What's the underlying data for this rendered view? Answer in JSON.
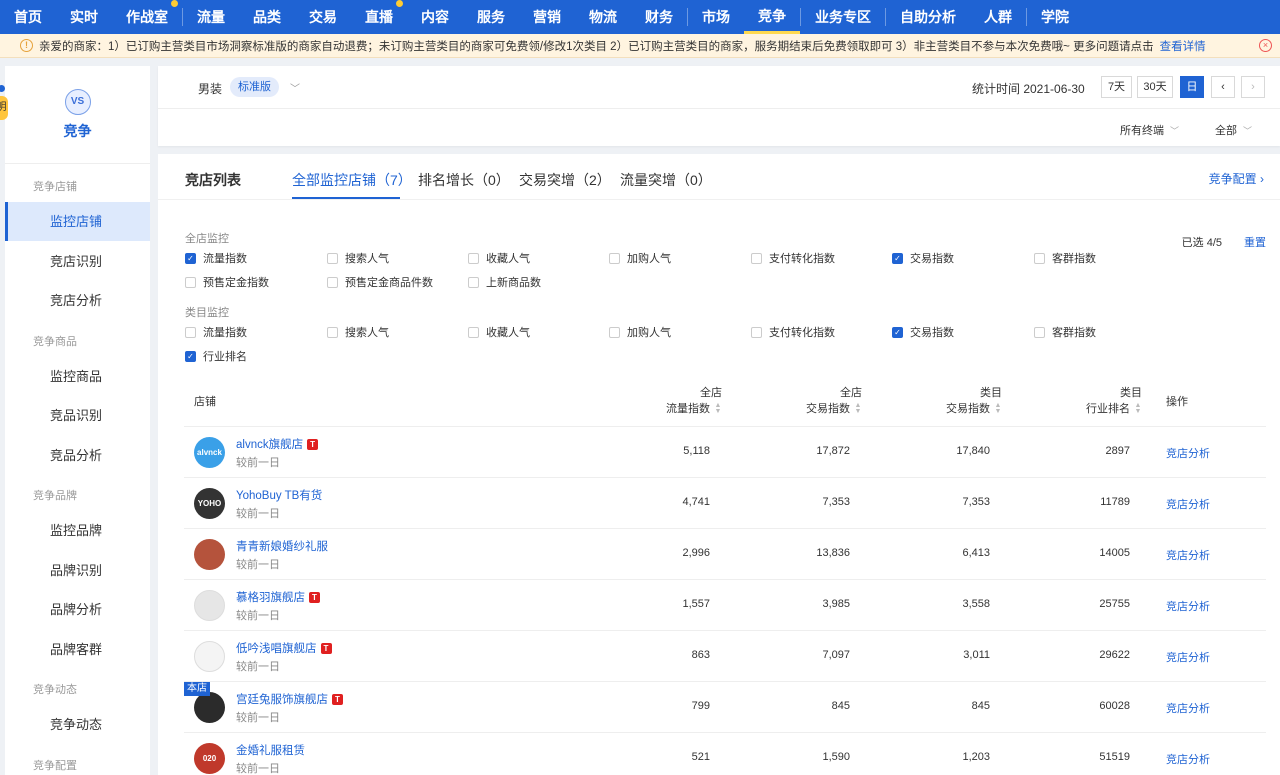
{
  "topnav": {
    "items": [
      {
        "label": "首页",
        "dot": false
      },
      {
        "label": "实时",
        "dot": false
      },
      {
        "label": "作战室",
        "dot": true
      },
      {
        "label": "流量",
        "dot": false
      },
      {
        "label": "品类",
        "dot": false
      },
      {
        "label": "交易",
        "dot": false
      },
      {
        "label": "直播",
        "dot": true
      },
      {
        "label": "内容",
        "dot": false
      },
      {
        "label": "服务",
        "dot": false
      },
      {
        "label": "营销",
        "dot": false
      },
      {
        "label": "物流",
        "dot": false
      },
      {
        "label": "财务",
        "dot": false
      },
      {
        "label": "市场",
        "dot": false
      },
      {
        "label": "竞争",
        "dot": false,
        "active": true
      },
      {
        "label": "业务专区",
        "dot": false
      },
      {
        "label": "自助分析",
        "dot": false
      },
      {
        "label": "人群",
        "dot": false
      },
      {
        "label": "学院",
        "dot": false
      }
    ]
  },
  "notice": {
    "text": "亲爱的商家：1）已订购主营类目市场洞察标准版的商家自动退费；未订购主营类目的商家可免费领/修改1次类目 2）已订购主营类目的商家，服务期结束后免费领取即可 3）非主营类目不参与本次免费哦~ 更多问题请点击",
    "link": "查看详情"
  },
  "sidebar": {
    "tag": "明",
    "logo_icon": "VS",
    "logo_label": "竞争",
    "groups": [
      {
        "label": "竞争店铺",
        "items": [
          "监控店铺",
          "竞店识别",
          "竞店分析"
        ]
      },
      {
        "label": "竞争商品",
        "items": [
          "监控商品",
          "竞品识别",
          "竞品分析"
        ]
      },
      {
        "label": "竞争品牌",
        "items": [
          "监控品牌",
          "品牌识别",
          "品牌分析",
          "品牌客群"
        ]
      },
      {
        "label": "竞争动态",
        "items": [
          "竞争动态"
        ]
      },
      {
        "label": "竞争配置",
        "items": []
      }
    ],
    "active_item": "监控店铺"
  },
  "filter": {
    "category": "男装",
    "edition": "标准版",
    "stat_time": "统计时间 2021-06-30",
    "range_buttons": [
      "7天",
      "30天",
      "日"
    ],
    "active_range": "日",
    "prev": "‹",
    "next": "›",
    "terminal": "所有终端",
    "scope": "全部"
  },
  "main": {
    "title": "竞店列表",
    "tabs": [
      "全部监控店铺（7）",
      "排名增长（0）",
      "交易突增（2）",
      "流量突增（0）"
    ],
    "config_link": "竞争配置 ›",
    "shop_monitor_label": "全店监控",
    "shop_metrics": [
      {
        "label": "流量指数",
        "checked": true
      },
      {
        "label": "搜索人气",
        "checked": false
      },
      {
        "label": "收藏人气",
        "checked": false
      },
      {
        "label": "加购人气",
        "checked": false
      },
      {
        "label": "支付转化指数",
        "checked": false
      },
      {
        "label": "交易指数",
        "checked": true
      },
      {
        "label": "客群指数",
        "checked": false
      },
      {
        "label": "预售定金指数",
        "checked": false
      },
      {
        "label": "预售定金商品件数",
        "checked": false
      },
      {
        "label": "上新商品数",
        "checked": false
      }
    ],
    "cat_monitor_label": "类目监控",
    "cat_metrics": [
      {
        "label": "流量指数",
        "checked": false
      },
      {
        "label": "搜索人气",
        "checked": false
      },
      {
        "label": "收藏人气",
        "checked": false
      },
      {
        "label": "加购人气",
        "checked": false
      },
      {
        "label": "支付转化指数",
        "checked": false
      },
      {
        "label": "交易指数",
        "checked": true
      },
      {
        "label": "客群指数",
        "checked": false
      },
      {
        "label": "行业排名",
        "checked": true
      }
    ],
    "selected_count": "已选 4/5",
    "reset": "重置"
  },
  "table": {
    "headers": {
      "shop": "店铺",
      "c1": [
        "全店",
        "流量指数"
      ],
      "c2": [
        "全店",
        "交易指数"
      ],
      "c3": [
        "类目",
        "交易指数"
      ],
      "c4": [
        "类目",
        "行业排名"
      ],
      "op": "操作"
    },
    "rows": [
      {
        "name": "alvnck旗舰店",
        "tmall": true,
        "own": false,
        "sub": "较前一日",
        "avatar_text": "alvnck",
        "avatar_color": "#3aa0e8",
        "v1": "5,118",
        "v2": "17,872",
        "v3": "17,840",
        "v4": "2897",
        "op": "竞店分析"
      },
      {
        "name": "YohoBuy TB有货",
        "tmall": false,
        "own": false,
        "sub": "较前一日",
        "avatar_text": "YOHO",
        "avatar_color": "#333333",
        "v1": "4,741",
        "v2": "7,353",
        "v3": "7,353",
        "v4": "11789",
        "op": "竞店分析"
      },
      {
        "name": "青青新娘婚纱礼服",
        "tmall": false,
        "own": false,
        "sub": "较前一日",
        "avatar_text": "",
        "avatar_color": "#b5533c",
        "v1": "2,996",
        "v2": "13,836",
        "v3": "6,413",
        "v4": "14005",
        "op": "竞店分析"
      },
      {
        "name": "慕格羽旗舰店",
        "tmall": true,
        "own": false,
        "sub": "较前一日",
        "avatar_text": "",
        "avatar_color": "#e6e6e6",
        "v1": "1,557",
        "v2": "3,985",
        "v3": "3,558",
        "v4": "25755",
        "op": "竞店分析"
      },
      {
        "name": "低吟浅唱旗舰店",
        "tmall": true,
        "own": false,
        "sub": "较前一日",
        "avatar_text": "",
        "avatar_color": "#f4f4f4",
        "v1": "863",
        "v2": "7,097",
        "v3": "3,011",
        "v4": "29622",
        "op": "竞店分析"
      },
      {
        "name": "宫廷兔服饰旗舰店",
        "tmall": true,
        "own": true,
        "own_label": "本店",
        "sub": "较前一日",
        "avatar_text": "",
        "avatar_color": "#2b2b2b",
        "v1": "799",
        "v2": "845",
        "v3": "845",
        "v4": "60028",
        "op": "竞店分析"
      },
      {
        "name": "金婚礼服租赁",
        "tmall": false,
        "own": false,
        "sub": "较前一日",
        "avatar_text": "020",
        "avatar_color": "#c0392b",
        "v1": "521",
        "v2": "1,590",
        "v3": "1,203",
        "v4": "51519",
        "op": "竞店分析"
      }
    ]
  }
}
